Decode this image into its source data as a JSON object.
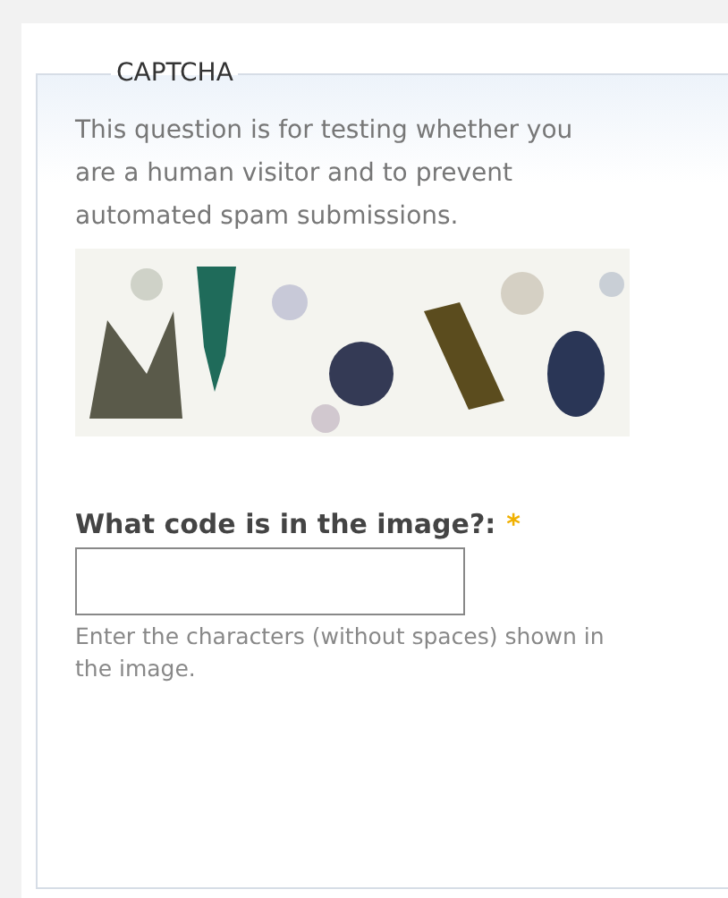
{
  "fieldset": {
    "legend": "CAPTCHA",
    "description": "This question is for testing whether you are a human visitor and to prevent automated spam submissions.",
    "field": {
      "label": "What code is in the image?:",
      "required_mark": "*",
      "required": true,
      "description": "Enter the characters (without spaces) shown in the image."
    }
  }
}
